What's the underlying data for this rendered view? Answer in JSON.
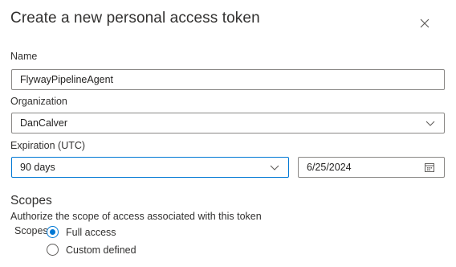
{
  "dialog": {
    "title": "Create a new personal access token",
    "close_icon": "close-icon"
  },
  "form": {
    "name": {
      "label": "Name",
      "value": "FlywayPipelineAgent"
    },
    "organization": {
      "label": "Organization",
      "value": "DanCalver",
      "icon": "chevron-down-icon"
    },
    "expiration": {
      "label": "Expiration (UTC)",
      "value": "90 days",
      "icon": "chevron-down-icon",
      "date_value": "6/25/2024",
      "date_icon": "calendar-icon"
    }
  },
  "scopes": {
    "title": "Scopes",
    "description": "Authorize the scope of access associated with this token",
    "label": "Scopes",
    "options": [
      {
        "label": "Full access",
        "selected": true
      },
      {
        "label": "Custom defined",
        "selected": false
      }
    ]
  },
  "colors": {
    "accent": "#0078d4",
    "border": "#8a8886",
    "text": "#323130"
  }
}
